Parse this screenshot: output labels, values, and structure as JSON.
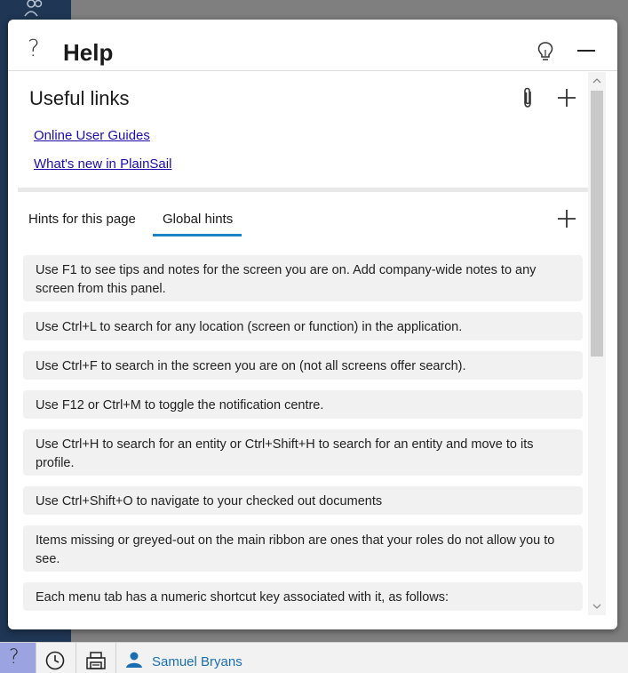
{
  "panel": {
    "title": "Help",
    "help_glyph": "?",
    "icons": [
      "question-icon",
      "lightbulb-icon",
      "minimize-icon"
    ]
  },
  "useful_links": {
    "title": "Useful links",
    "links": [
      "Online User Guides",
      "What's new in PlainSail"
    ],
    "icons": [
      "paperclip-icon",
      "plus-icon"
    ]
  },
  "hints": {
    "tabs": [
      {
        "label": "Hints for this page",
        "active": false
      },
      {
        "label": "Global hints",
        "active": true
      }
    ],
    "items": [
      "Use F1 to see tips and notes for the screen you are on. Add company-wide notes to any screen from this panel.",
      "Use Ctrl+L to search for any location (screen or function) in the application.",
      "Use Ctrl+F to search in the screen you are on (not all screens offer search).",
      "Use F12 or Ctrl+M to toggle the notification centre.",
      "Use Ctrl+H to search for an entity or Ctrl+Shift+H to search for an entity and move to its profile.",
      "Use Ctrl+Shift+O to navigate to your checked out documents",
      "Items missing or greyed-out on the main ribbon are ones that your roles do not allow you to see.",
      "Each menu tab has a numeric shortcut key associated with it, as follows:"
    ]
  },
  "taskbar": {
    "help_glyph": "?",
    "user_name": "Samuel Bryans",
    "icons": [
      "question-icon",
      "clock-icon",
      "printer-icon",
      "user-icon"
    ]
  },
  "colors": {
    "accent": "#1a84c6",
    "link": "#1a0dab",
    "sidebar": "#1f3654",
    "help_button": "#9ba4e0",
    "hint_background": "#f1f1f1"
  }
}
